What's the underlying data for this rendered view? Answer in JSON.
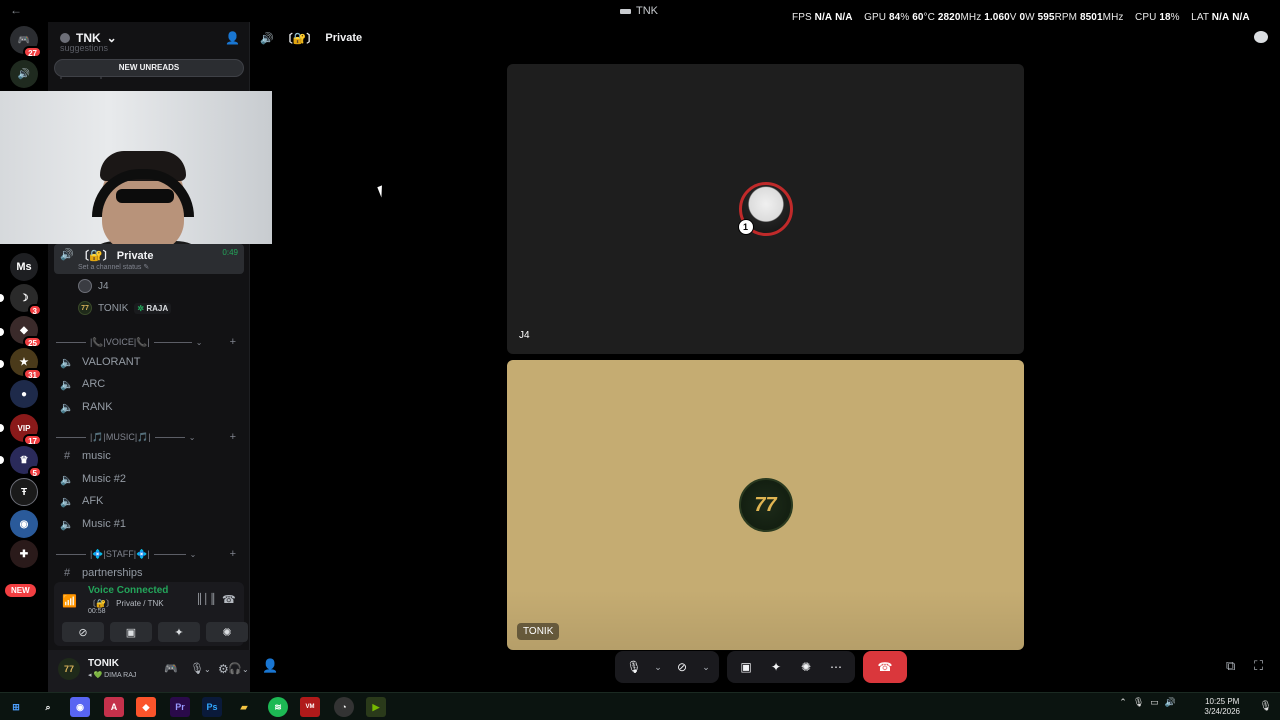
{
  "window": {
    "title": "TNK",
    "back_icon": "arrow-left-icon"
  },
  "overlay": {
    "fps_label": "FPS",
    "fps_1": "N/A",
    "fps_2": "N/A",
    "gpu_label": "GPU",
    "gpu_load": "84",
    "gpu_load_unit": "%",
    "gpu_temp": "60",
    "gpu_temp_unit": "°C",
    "gpu_clock": "2820",
    "gpu_clock_unit": "MHz",
    "gpu_volt": "1.060",
    "gpu_volt_unit": "V",
    "gpu_power": "0",
    "gpu_power_unit": "W",
    "fan": "595",
    "fan_unit": "RPM",
    "mem_clock": "8501",
    "mem_clock_unit": "MHz",
    "cpu_label": "CPU",
    "cpu_load": "18",
    "cpu_load_unit": "%",
    "lat_label": "LAT",
    "lat_1": "N/A",
    "lat_2": "N/A"
  },
  "rail": {
    "dm_badge": "27",
    "ms_label": "Ms",
    "badges": [
      "3",
      "25",
      "31",
      "17",
      "5"
    ],
    "new_label": "NEW"
  },
  "server": {
    "name": "TNK",
    "scroll_ghost_top": "suggestions",
    "scroll_ghost": "partnership",
    "new_unreads": "NEW UNREADS"
  },
  "active_channel": {
    "prefix": "〔🔐〕",
    "name": "Private",
    "timer": "0:49",
    "status": "Set a channel status"
  },
  "voice_users": [
    {
      "name": "J4"
    },
    {
      "name": "TONIK",
      "tag": "RAJA"
    }
  ],
  "categories": {
    "voice": "|📞|VOICE|📞|",
    "music": "|🎵|MUSIC|🎵|",
    "staff": "|💠|STAFF|💠|"
  },
  "channels": {
    "valorant": "VALORANT",
    "arc": "ARC",
    "rank": "RANK",
    "music": "music",
    "music2": "Music #2",
    "afk": "AFK",
    "music1": "Music #1",
    "partnerships": "partnerships"
  },
  "voice_panel": {
    "title": "Voice Connected",
    "sub": "〔🔐〕 Private / TNK",
    "time": "00:58"
  },
  "user_panel": {
    "name": "TONIK",
    "status": "DIMA RAJ",
    "avatar_text": "77"
  },
  "voice_header": {
    "prefix": "〔🔐〕",
    "title": "Private"
  },
  "tiles": [
    {
      "label": "J4",
      "badge": "1"
    },
    {
      "label": "TONIK",
      "avatar_text": "77"
    }
  ],
  "taskbar": {
    "time": "10:25 PM",
    "date": "3/24/2026"
  }
}
